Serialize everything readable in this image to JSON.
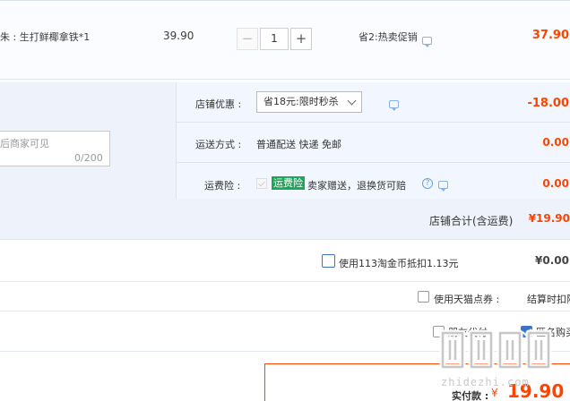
{
  "item": {
    "name": "朱 : 生打鲜椰拿铁*1",
    "unit_price": "39.90",
    "qty_minus": "−",
    "quantity": "1",
    "qty_plus": "+",
    "promo": "省2:热卖促销",
    "total": "37.90"
  },
  "shop": {
    "discount_label": "店铺优惠 :",
    "discount_option": "省18元:限时秒杀",
    "discount_amount": "-18.00",
    "memo_placeholder": "后商家可见",
    "memo_count": "0/200",
    "shipping_label": "运送方式 :",
    "shipping_text": "普通配送 快递 免邮",
    "shipping_amount": "0.00",
    "insurance_label": "运费险 :",
    "insurance_badge": "运费险",
    "insurance_text": "卖家赠送，退换货可赔",
    "insurance_amount": "0.00",
    "total_label": "店铺合计(含运费)",
    "total_amount": "¥19.90"
  },
  "coins": {
    "label": "使用113淘金币抵扣1.13元",
    "amount": "¥0.00"
  },
  "points": {
    "label": "使用天猫点券 :",
    "settle": "结算时扣除"
  },
  "options": {
    "friend_pay": "朋友代付",
    "anonymous": "匿名购买"
  },
  "final": {
    "label": "实付款 :",
    "currency": "¥",
    "amount": "19.90"
  },
  "watermark": {
    "text": "zhidezhi.com"
  },
  "colors": {
    "accent": "#ff4400",
    "link": "#3b73c9",
    "panel": "#eef3fb",
    "badge": "#1fa55b"
  }
}
